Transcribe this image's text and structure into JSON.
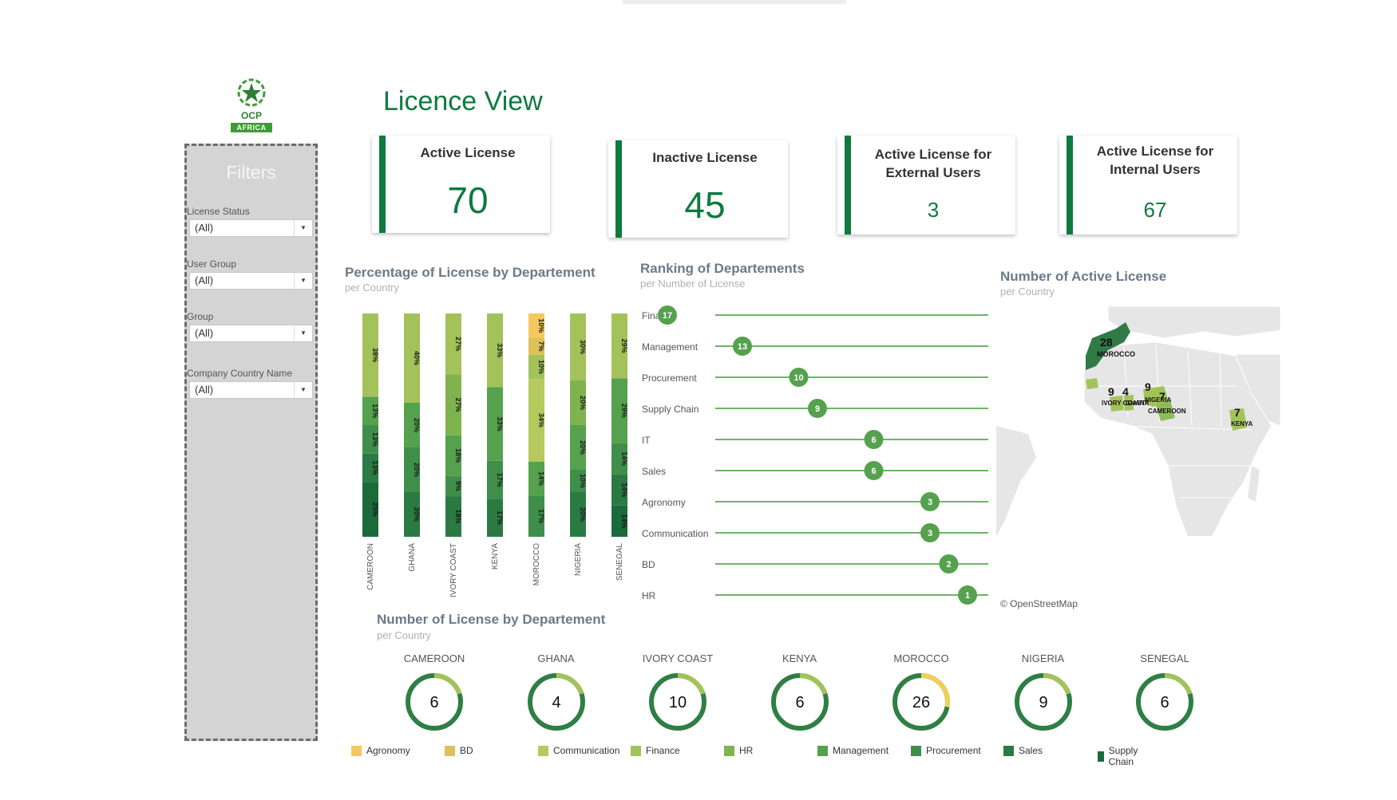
{
  "logo": {
    "name": "OCP",
    "badge": "AFRICA"
  },
  "page_title": "Licence View",
  "filters": {
    "title": "Filters",
    "items": [
      {
        "label": "License Status",
        "value": "(All)"
      },
      {
        "label": "User Group",
        "value": "(All)"
      },
      {
        "label": "Group",
        "value": "(All)"
      },
      {
        "label": "Company Country Name",
        "value": "(All)"
      }
    ]
  },
  "kpis": [
    {
      "label": "Active License",
      "value": "70"
    },
    {
      "label": "Inactive License",
      "value": "45"
    },
    {
      "label": "Active License for External Users",
      "value": "3"
    },
    {
      "label": "Active License for Internal Users",
      "value": "67"
    }
  ],
  "colors": {
    "accent": "#0e7a3f",
    "Agronomy": "#f5c85c",
    "BD": "#dcc25a",
    "Communication": "#b5c95d",
    "Finance": "#a3c35a",
    "HR": "#7fb34e",
    "Management": "#55a14e",
    "Procurement": "#3f8f4b",
    "Sales": "#2b7a43",
    "Supply Chain": "#1a6a3a"
  },
  "sections": {
    "pct": {
      "title": "Percentage of License by Departement",
      "subtitle": "per Country"
    },
    "rank": {
      "title": "Ranking of Departements",
      "subtitle": "per Number of License"
    },
    "map": {
      "title": "Number of Active License",
      "subtitle": "per Country",
      "credit": "© OpenStreetMap"
    },
    "num": {
      "title": "Number of License by Departement",
      "subtitle": "per Country"
    }
  },
  "chart_data": [
    {
      "type": "bar",
      "title": "Percentage of License by Departement",
      "subtitle": "per Country",
      "categories": [
        "CAMEROON",
        "GHANA",
        "IVORY COAST",
        "KENYA",
        "MOROCCO",
        "NIGERIA",
        "SENEGAL"
      ],
      "stacks": [
        [
          {
            "v": 25,
            "c": "Supply Chain"
          },
          {
            "v": 13,
            "c": "Sales"
          },
          {
            "v": 13,
            "c": "Procurement"
          },
          {
            "v": 13,
            "c": "Management"
          },
          {
            "v": 38,
            "c": "Finance"
          }
        ],
        [
          {
            "v": 20,
            "c": "Sales"
          },
          {
            "v": 20,
            "c": "Procurement"
          },
          {
            "v": 20,
            "c": "Management"
          },
          {
            "v": 40,
            "c": "Finance"
          }
        ],
        [
          {
            "v": 18,
            "c": "Sales"
          },
          {
            "v": 9,
            "c": "Procurement"
          },
          {
            "v": 18,
            "c": "Management"
          },
          {
            "v": 27,
            "c": "HR"
          },
          {
            "v": 27,
            "c": "Finance"
          }
        ],
        [
          {
            "v": 17,
            "c": "Sales"
          },
          {
            "v": 17,
            "c": "Procurement"
          },
          {
            "v": 33,
            "c": "Management"
          },
          {
            "v": 33,
            "c": "Finance"
          }
        ],
        [
          {
            "v": 17,
            "c": "Procurement"
          },
          {
            "v": 14,
            "c": "Management"
          },
          {
            "v": 34,
            "c": "Communication"
          },
          {
            "v": 10,
            "c": "Finance"
          },
          {
            "v": 7,
            "c": "BD"
          },
          {
            "v": 10,
            "c": "Agronomy"
          }
        ],
        [
          {
            "v": 20,
            "c": "Sales"
          },
          {
            "v": 10,
            "c": "Procurement"
          },
          {
            "v": 20,
            "c": "Management"
          },
          {
            "v": 20,
            "c": "HR"
          },
          {
            "v": 30,
            "c": "Finance"
          }
        ],
        [
          {
            "v": 14,
            "c": "Supply Chain"
          },
          {
            "v": 14,
            "c": "Sales"
          },
          {
            "v": 14,
            "c": "Procurement"
          },
          {
            "v": 29,
            "c": "Management"
          },
          {
            "v": 29,
            "c": "Finance"
          }
        ]
      ],
      "ylim": [
        0,
        100
      ]
    },
    {
      "type": "scatter",
      "title": "Ranking of Departements",
      "subtitle": "per Number of License",
      "categories": [
        "Finance",
        "Management",
        "Procurement",
        "Supply Chain",
        "IT",
        "Sales",
        "Agronomy",
        "Communication",
        "BD",
        "HR"
      ],
      "values": [
        17,
        13,
        10,
        9,
        6,
        6,
        3,
        3,
        2,
        1
      ],
      "axis": "reversed"
    },
    {
      "type": "map",
      "title": "Number of Active License",
      "subtitle": "per Country",
      "points": [
        {
          "country": "MOROCCO",
          "value": 28
        },
        {
          "country": "IVORY COAST",
          "value": 9
        },
        {
          "country": "GHANA",
          "value": 4
        },
        {
          "country": "NIGERIA",
          "value": 9
        },
        {
          "country": "CAMEROON",
          "value": 7
        },
        {
          "country": "KENYA",
          "value": 7
        }
      ]
    },
    {
      "type": "pie",
      "title": "Number of License by Departement",
      "subtitle": "per Country",
      "categories": [
        "CAMEROON",
        "GHANA",
        "IVORY COAST",
        "KENYA",
        "MOROCCO",
        "NIGERIA",
        "SENEGAL"
      ],
      "values": [
        6,
        4,
        10,
        6,
        26,
        9,
        6
      ]
    }
  ],
  "legend": [
    "Agronomy",
    "BD",
    "Communication",
    "Finance",
    "HR",
    "Management",
    "Procurement",
    "Sales",
    "Supply Chain"
  ]
}
